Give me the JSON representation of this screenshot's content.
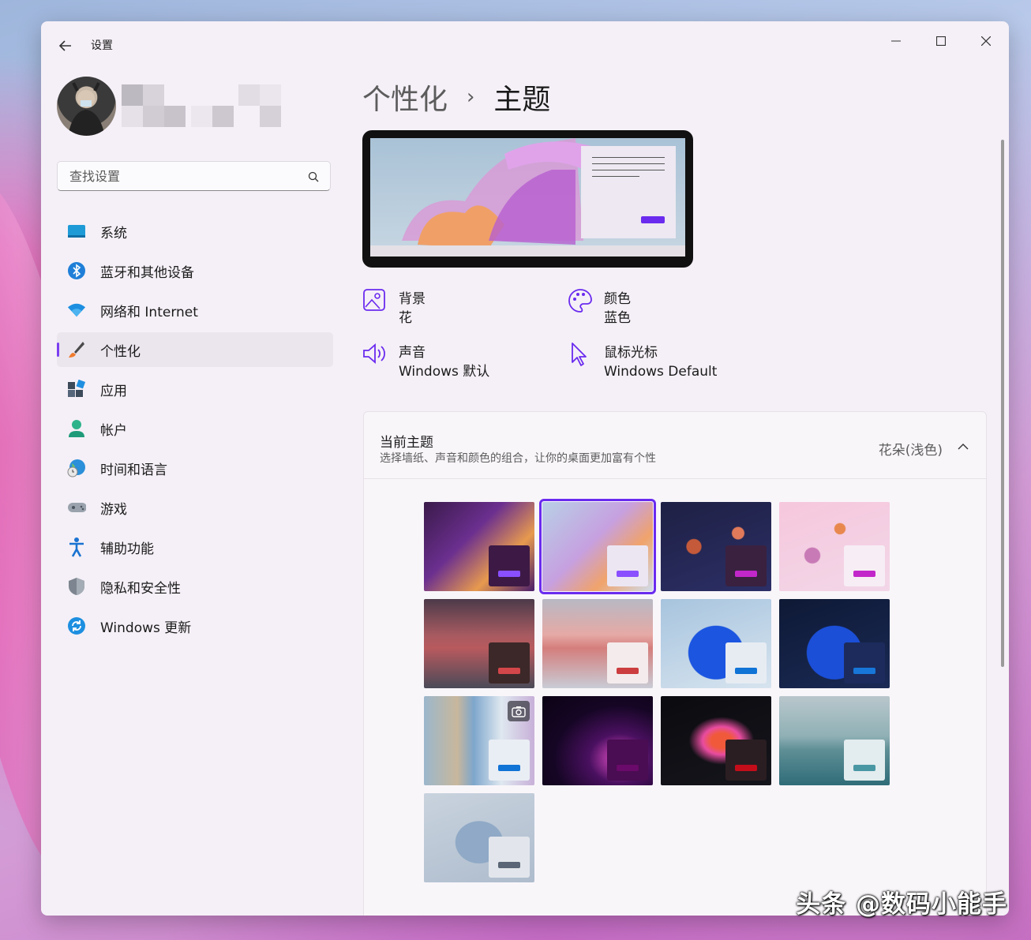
{
  "window": {
    "title": "设置",
    "back_icon": "back-arrow-icon",
    "controls": [
      "minimize",
      "maximize",
      "close"
    ]
  },
  "search": {
    "placeholder": "查找设置",
    "value": ""
  },
  "nav": [
    {
      "label": "系统",
      "icon": "display-icon"
    },
    {
      "label": "蓝牙和其他设备",
      "icon": "bluetooth-icon"
    },
    {
      "label": "网络和 Internet",
      "icon": "wifi-icon"
    },
    {
      "label": "个性化",
      "icon": "brush-icon",
      "active": true
    },
    {
      "label": "应用",
      "icon": "apps-icon"
    },
    {
      "label": "帐户",
      "icon": "person-icon"
    },
    {
      "label": "时间和语言",
      "icon": "globe-clock-icon"
    },
    {
      "label": "游戏",
      "icon": "gamepad-icon"
    },
    {
      "label": "辅助功能",
      "icon": "accessibility-icon"
    },
    {
      "label": "隐私和安全性",
      "icon": "shield-icon"
    },
    {
      "label": "Windows 更新",
      "icon": "update-icon"
    }
  ],
  "breadcrumb": {
    "parent": "个性化",
    "separator": "›",
    "current": "主题"
  },
  "properties": [
    {
      "title": "背景",
      "value": "花",
      "icon": "image-icon"
    },
    {
      "title": "颜色",
      "value": "蓝色",
      "icon": "palette-icon"
    },
    {
      "title": "声音",
      "value": "Windows 默认",
      "icon": "speaker-icon"
    },
    {
      "title": "鼠标光标",
      "value": "Windows Default",
      "icon": "cursor-icon"
    }
  ],
  "current_theme": {
    "title": "当前主题",
    "subtitle": "选择墙纸、声音和颜色的组合，让你的桌面更加富有个性",
    "value": "花朵(浅色)"
  },
  "accent_color": "#6a2bef",
  "themes": [
    {
      "name": "bloom-dark",
      "bg": "linear-gradient(135deg,#3a1a4a,#6b2f8f 40%,#e79a4e 70%,#4a1d6b)",
      "mini": "#3d1a45",
      "btn": "#8a4fff"
    },
    {
      "name": "bloom-light",
      "bg": "linear-gradient(135deg,#b8d0e6,#c6a0e0 45%,#f0a36b 70%,#cfdcec)",
      "mini": "#ece6f3",
      "btn": "#8a4fff",
      "selected": true
    },
    {
      "name": "planets-dark",
      "bg": "radial-gradient(circle at 30% 50%,#c45a3a 0 8%,transparent 9%),radial-gradient(circle at 70% 35%,#e07a5a 0 6%,transparent 7%),linear-gradient(160deg,#1e2044,#2c2f66)",
      "mini": "#3a2140",
      "btn": "#c227c9"
    },
    {
      "name": "planets-light",
      "bg": "radial-gradient(circle at 30% 60%,#c87ab6 0 8%,transparent 9%),radial-gradient(circle at 55% 30%,#e8884e 0 6%,transparent 7%),linear-gradient(160deg,#f6c7dd,#f2d7e8)",
      "mini": "#f7eef5",
      "btn": "#c227c9"
    },
    {
      "name": "dunes-dark",
      "bg": "linear-gradient(180deg,#4c3a4a 0%,#a65a60 40%,#b85a5e 55%,#4a4a58 100%)",
      "mini": "#3c2828",
      "btn": "#d3464a"
    },
    {
      "name": "dunes-light",
      "bg": "linear-gradient(180deg,#b7b9c4 0%,#e6a9a5 40%,#d47e7c 55%,#c9ccd6 100%)",
      "mini": "#f4ecec",
      "btn": "#cc3d3f"
    },
    {
      "name": "glow-light",
      "bg": "radial-gradient(ellipse at 50% 60%,#1b55e0 0 35%,transparent 36%),linear-gradient(160deg,#a7c4de,#d7e4ef)",
      "mini": "#e7ecf3",
      "btn": "#1073d6"
    },
    {
      "name": "glow-dark",
      "bg": "radial-gradient(ellipse at 50% 60%,#1b4fd8 0 35%,transparent 36%),linear-gradient(160deg,#0e1935,#1a2a55)",
      "mini": "#1c2b5c",
      "btn": "#1776d8"
    },
    {
      "name": "spotlight",
      "bg": "linear-gradient(90deg,#9bb7cc 0%,#c8b79c 30%,#7ea6cc 45%,#dfe8f0 70%,#c8b0d8 100%)",
      "mini": "#e9eef4",
      "btn": "#1073d6",
      "camera": true
    },
    {
      "name": "captured-motion",
      "bg": "radial-gradient(ellipse at 70% 70%,#b23aa6 0 10%,#4a1060 28%,#160625 60%,#0b0214 100%)",
      "mini": "#4a0c52",
      "btn": "#6a0a6a"
    },
    {
      "name": "flow",
      "bg": "radial-gradient(ellipse at 55% 50%,#f05a3a 0 12%,#e94ca0 22%,transparent 38%),linear-gradient(160deg,#0b0b0f,#15151c)",
      "mini": "#2a1e22",
      "btn": "#c40d1a"
    },
    {
      "name": "sunrise",
      "bg": "linear-gradient(180deg,#b9c7cc 0%,#8fb0b5 45%,#5f8f96 60%,#2f6c78 100%)",
      "mini": "#e3ecee",
      "btn": "#4a97a4"
    },
    {
      "name": "windows-glass",
      "bg": "radial-gradient(ellipse at 50% 55%,#8fa9c6 0 30%,transparent 31%),linear-gradient(160deg,#c9d3de,#aebccd)",
      "mini": "#e2e6ec",
      "btn": "#5a6675"
    }
  ],
  "watermark": "头条 @数码小能手"
}
